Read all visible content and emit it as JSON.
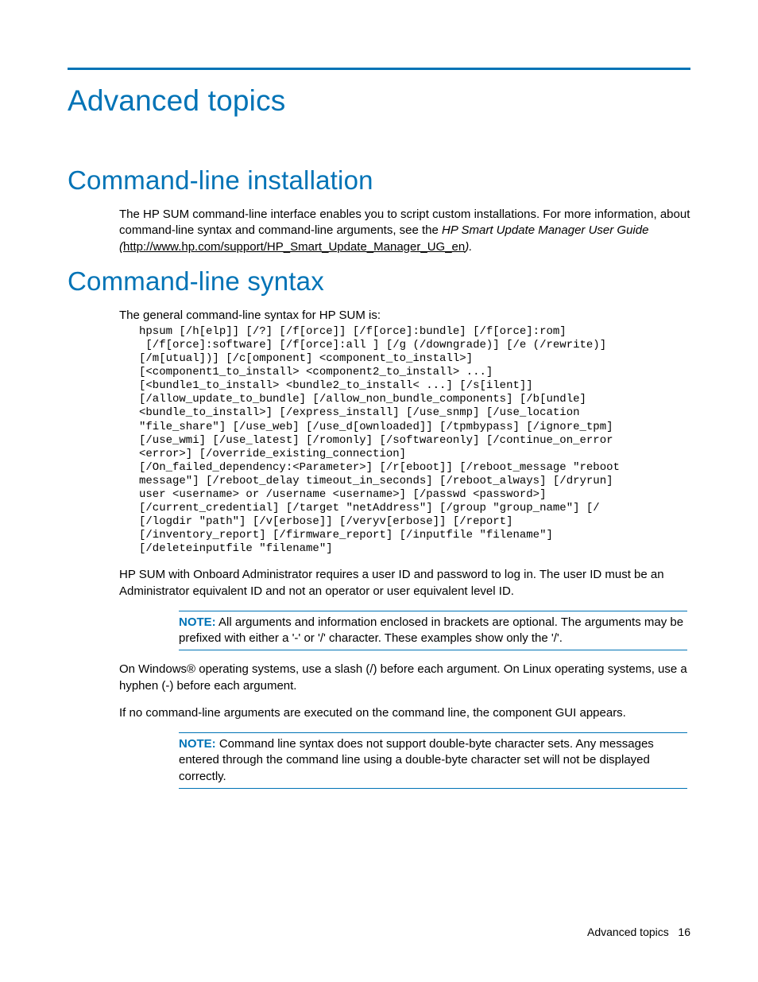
{
  "title": "Advanced topics",
  "section1": {
    "heading": "Command-line installation",
    "intro_a": "The HP SUM command-line interface enables you to script custom installations. For more information, about command-line syntax and command-line arguments, see the ",
    "intro_italic": "HP Smart Update Manager User Guide (",
    "link": "http://www.hp.com/support/HP_Smart_Update_Manager_UG_en",
    "intro_close": ")."
  },
  "section2": {
    "heading": "Command-line syntax",
    "lead": "The general command-line syntax for HP SUM is:",
    "code": "hpsum [/h[elp]] [/?] [/f[orce]] [/f[orce]:bundle] [/f[orce]:rom]\n [/f[orce]:software] [/f[orce]:all ] [/g (/downgrade)] [/e (/rewrite)]\n[/m[utual])] [/c[omponent] <component_to_install>]\n[<component1_to_install> <component2_to_install> ...]\n[<bundle1_to_install> <bundle2_to_install< ...] [/s[ilent]]\n[/allow_update_to_bundle] [/allow_non_bundle_components] [/b[undle]\n<bundle_to_install>] [/express_install] [/use_snmp] [/use_location\n\"file_share\"] [/use_web] [/use_d[ownloaded]] [/tpmbypass] [/ignore_tpm]\n[/use_wmi] [/use_latest] [/romonly] [/softwareonly] [/continue_on_error\n<error>] [/override_existing_connection]\n[/On_failed_dependency:<Parameter>] [/r[eboot]] [/reboot_message \"reboot\nmessage\"] [/reboot_delay timeout_in_seconds] [/reboot_always] [/dryrun]\nuser <username> or /username <username>] [/passwd <password>]\n[/current_credential] [/target \"netAddress\"] [/group \"group_name\"] [/\n[/logdir \"path\"] [/v[erbose]] [/veryv[erbose]] [/report]\n[/inventory_report] [/firmware_report] [/inputfile \"filename\"]\n[/deleteinputfile \"filename\"]",
    "para2": "HP SUM with Onboard Administrator requires a user ID and password to log in. The user ID must be an Administrator equivalent ID and not an operator or user equivalent level ID.",
    "note1_label": "NOTE:",
    "note1_text": "  All arguments and information enclosed in brackets are optional. The arguments may be prefixed with either a '-' or '/' character. These examples show only the '/'.",
    "para3": "On Windows® operating systems, use a slash (/) before each argument. On Linux operating systems, use a hyphen (-) before each argument.",
    "para4": "If no command-line arguments are executed on the command line, the component GUI appears.",
    "note2_label": "NOTE:",
    "note2_text": "  Command line syntax does not support double-byte character sets. Any messages entered through the command line using a double-byte character set will not be displayed correctly."
  },
  "footer": {
    "label": "Advanced topics",
    "page": "16"
  }
}
